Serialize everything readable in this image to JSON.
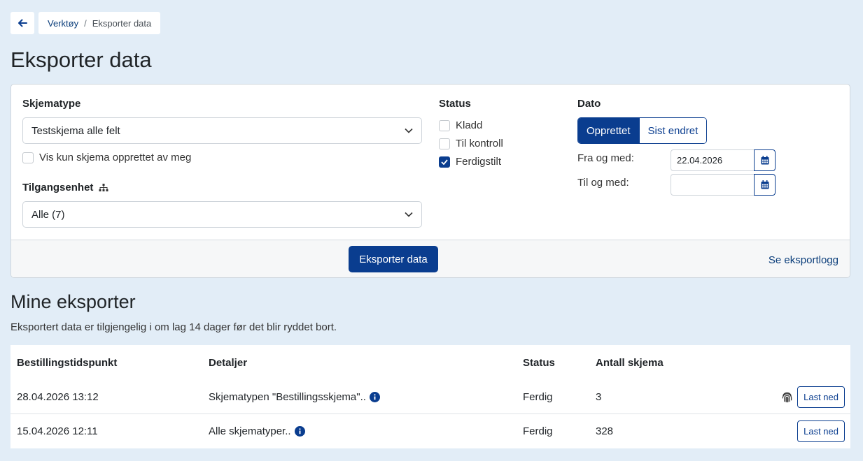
{
  "breadcrumb": {
    "parent": "Verktøy",
    "separator": "/",
    "current": "Eksporter data"
  },
  "page_title": "Eksporter data",
  "filters": {
    "schema_type": {
      "label": "Skjematype",
      "value": "Testskjema alle felt"
    },
    "only_mine": {
      "label": "Vis kun skjema opprettet av meg",
      "checked": false
    },
    "access_unit": {
      "label": "Tilgangsenhet",
      "value": "Alle (7)"
    },
    "status": {
      "label": "Status",
      "options": [
        {
          "label": "Kladd",
          "checked": false
        },
        {
          "label": "Til kontroll",
          "checked": false
        },
        {
          "label": "Ferdigstilt",
          "checked": true
        }
      ]
    },
    "date": {
      "label": "Dato",
      "toggle": [
        "Opprettet",
        "Sist endret"
      ],
      "from_label": "Fra og med:",
      "from_value": "22.04.2026",
      "to_label": "Til og med:",
      "to_value": ""
    }
  },
  "footer": {
    "export_button": "Eksporter data",
    "log_link": "Se eksportlogg"
  },
  "exports": {
    "title": "Mine eksporter",
    "description": "Eksportert data er tilgjengelig i om lag 14 dager før det blir ryddet bort.",
    "columns": [
      "Bestillingstidspunkt",
      "Detaljer",
      "Status",
      "Antall skjema"
    ],
    "rows": [
      {
        "time": "28.04.2026 13:12",
        "details": "Skjematypen \"Bestillingsskjema\"..",
        "status": "Ferdig",
        "count": "3",
        "action": "Last ned"
      },
      {
        "time": "15.04.2026 12:11",
        "details": "Alle skjematyper..",
        "status": "Ferdig",
        "count": "328",
        "action": "Last ned"
      }
    ]
  },
  "colors": {
    "primary": "#0a3d8f",
    "background": "#e2edf7"
  }
}
